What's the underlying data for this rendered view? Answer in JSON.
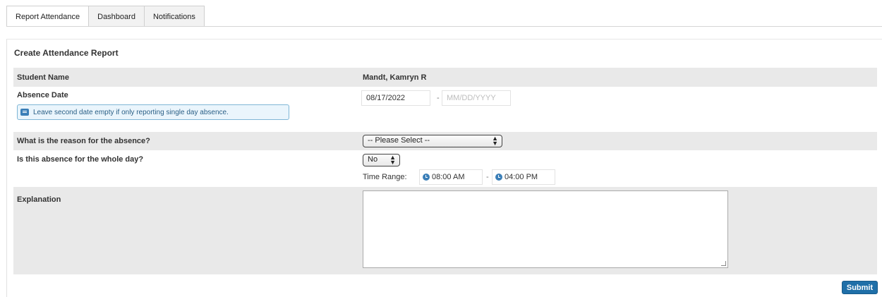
{
  "tabs": [
    {
      "label": "Report Attendance",
      "active": true
    },
    {
      "label": "Dashboard",
      "active": false
    },
    {
      "label": "Notifications",
      "active": false
    }
  ],
  "form": {
    "title": "Create Attendance Report",
    "student_name_label": "Student Name",
    "student_name_value": "Mandt, Kamryn R",
    "absence_date_label": "Absence Date",
    "absence_date_start": "08/17/2022",
    "absence_date_separator": "-",
    "absence_date_end_placeholder": "MM/DD/YYYY",
    "absence_date_hint": "Leave second date empty if only reporting single day absence.",
    "reason_label": "What is the reason for the absence?",
    "reason_selected": "-- Please Select --",
    "whole_day_label": "Is this absence for the whole day?",
    "whole_day_selected": "No",
    "time_range_label": "Time Range:",
    "time_start": "08:00 AM",
    "time_separator": "-",
    "time_end": "04:00 PM",
    "explanation_label": "Explanation",
    "explanation_value": "",
    "submit_label": "Submit"
  },
  "colors": {
    "accent": "#1f6fa8",
    "row_shade": "#e9e9e9",
    "hint_bg": "#eaf5fc",
    "hint_border": "#7fb6d6"
  }
}
